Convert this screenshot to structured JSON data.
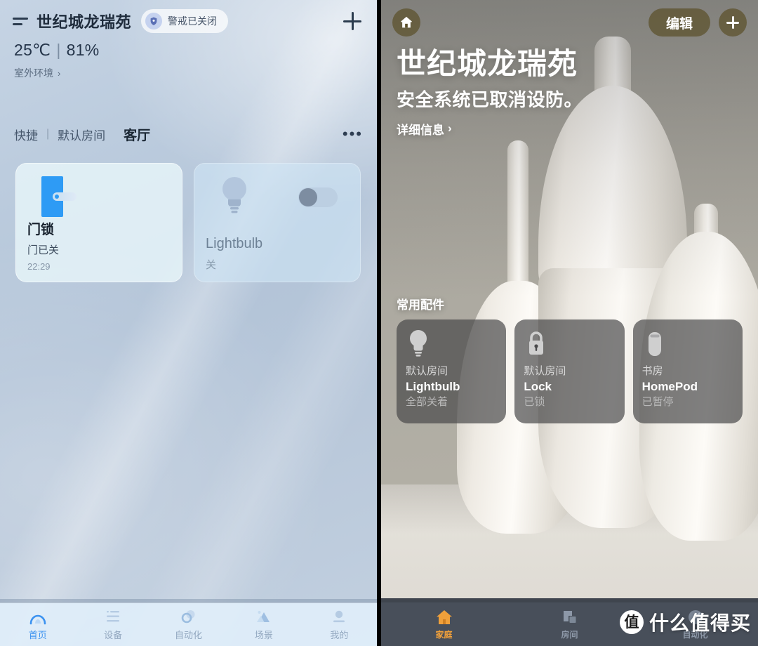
{
  "left_app": {
    "header": {
      "menu_icon": "list-lines-icon",
      "title": "世纪城龙瑞苑",
      "alarm_badge": {
        "icon": "shield-icon",
        "label": "警戒已关闭"
      },
      "add_icon": "plus-icon"
    },
    "weather": {
      "temperature": "25℃",
      "separator": "|",
      "humidity": "81%",
      "source_label": "室外环境",
      "chevron": "›"
    },
    "room_tabs": {
      "items": [
        {
          "label": "快捷",
          "active": false
        },
        {
          "label": "默认房间",
          "active": false
        },
        {
          "label": "客厅",
          "active": true
        }
      ],
      "separator": "|",
      "more_icon": "ellipsis-icon",
      "more_label": "•••"
    },
    "devices": [
      {
        "icon": "door-lock-icon",
        "name": "门锁",
        "state": "门已关",
        "time": "22:29",
        "has_toggle": false
      },
      {
        "icon": "lightbulb-icon",
        "name": "Lightbulb",
        "state": "关",
        "has_toggle": true,
        "toggle_on": false
      }
    ],
    "bottom_nav": [
      {
        "icon": "home-arch-icon",
        "label": "首页",
        "active": true
      },
      {
        "icon": "device-list-icon",
        "label": "设备",
        "active": false
      },
      {
        "icon": "automation-rings-icon",
        "label": "自动化",
        "active": false
      },
      {
        "icon": "scene-mountain-icon",
        "label": "场景",
        "active": false
      },
      {
        "icon": "profile-person-icon",
        "label": "我的",
        "active": false
      }
    ]
  },
  "right_app": {
    "header": {
      "home_icon": "house-icon",
      "edit_label": "编辑",
      "add_icon": "plus-icon"
    },
    "hero": {
      "home_name": "世纪城龙瑞苑",
      "status": "安全系统已取消设防。",
      "detail_label": "详细信息",
      "detail_chevron": "›"
    },
    "favorites": {
      "title": "常用配件",
      "items": [
        {
          "icon": "lightbulb-icon",
          "room": "默认房间",
          "name": "Lightbulb",
          "state": "全部关着"
        },
        {
          "icon": "lock-icon",
          "room": "默认房间",
          "name": "Lock",
          "state": "已锁"
        },
        {
          "icon": "homepod-icon",
          "room": "书房",
          "name": "HomePod",
          "state": "已暂停"
        }
      ]
    },
    "bottom_nav": [
      {
        "icon": "house-filled-icon",
        "label": "家庭",
        "active": true
      },
      {
        "icon": "rooms-grid-icon",
        "label": "房间",
        "active": false
      },
      {
        "icon": "automation-icon",
        "label": "自动化",
        "active": false
      }
    ]
  },
  "watermark": {
    "logo_char": "值",
    "text": "什么值得买"
  },
  "colors": {
    "left_accent": "#3b92f0",
    "left_bg": "#b6c6d9",
    "lock_blue": "#2e9bf5",
    "right_accent": "#f0a03a",
    "right_button": "#5c502a",
    "card_dark": "#444446"
  }
}
